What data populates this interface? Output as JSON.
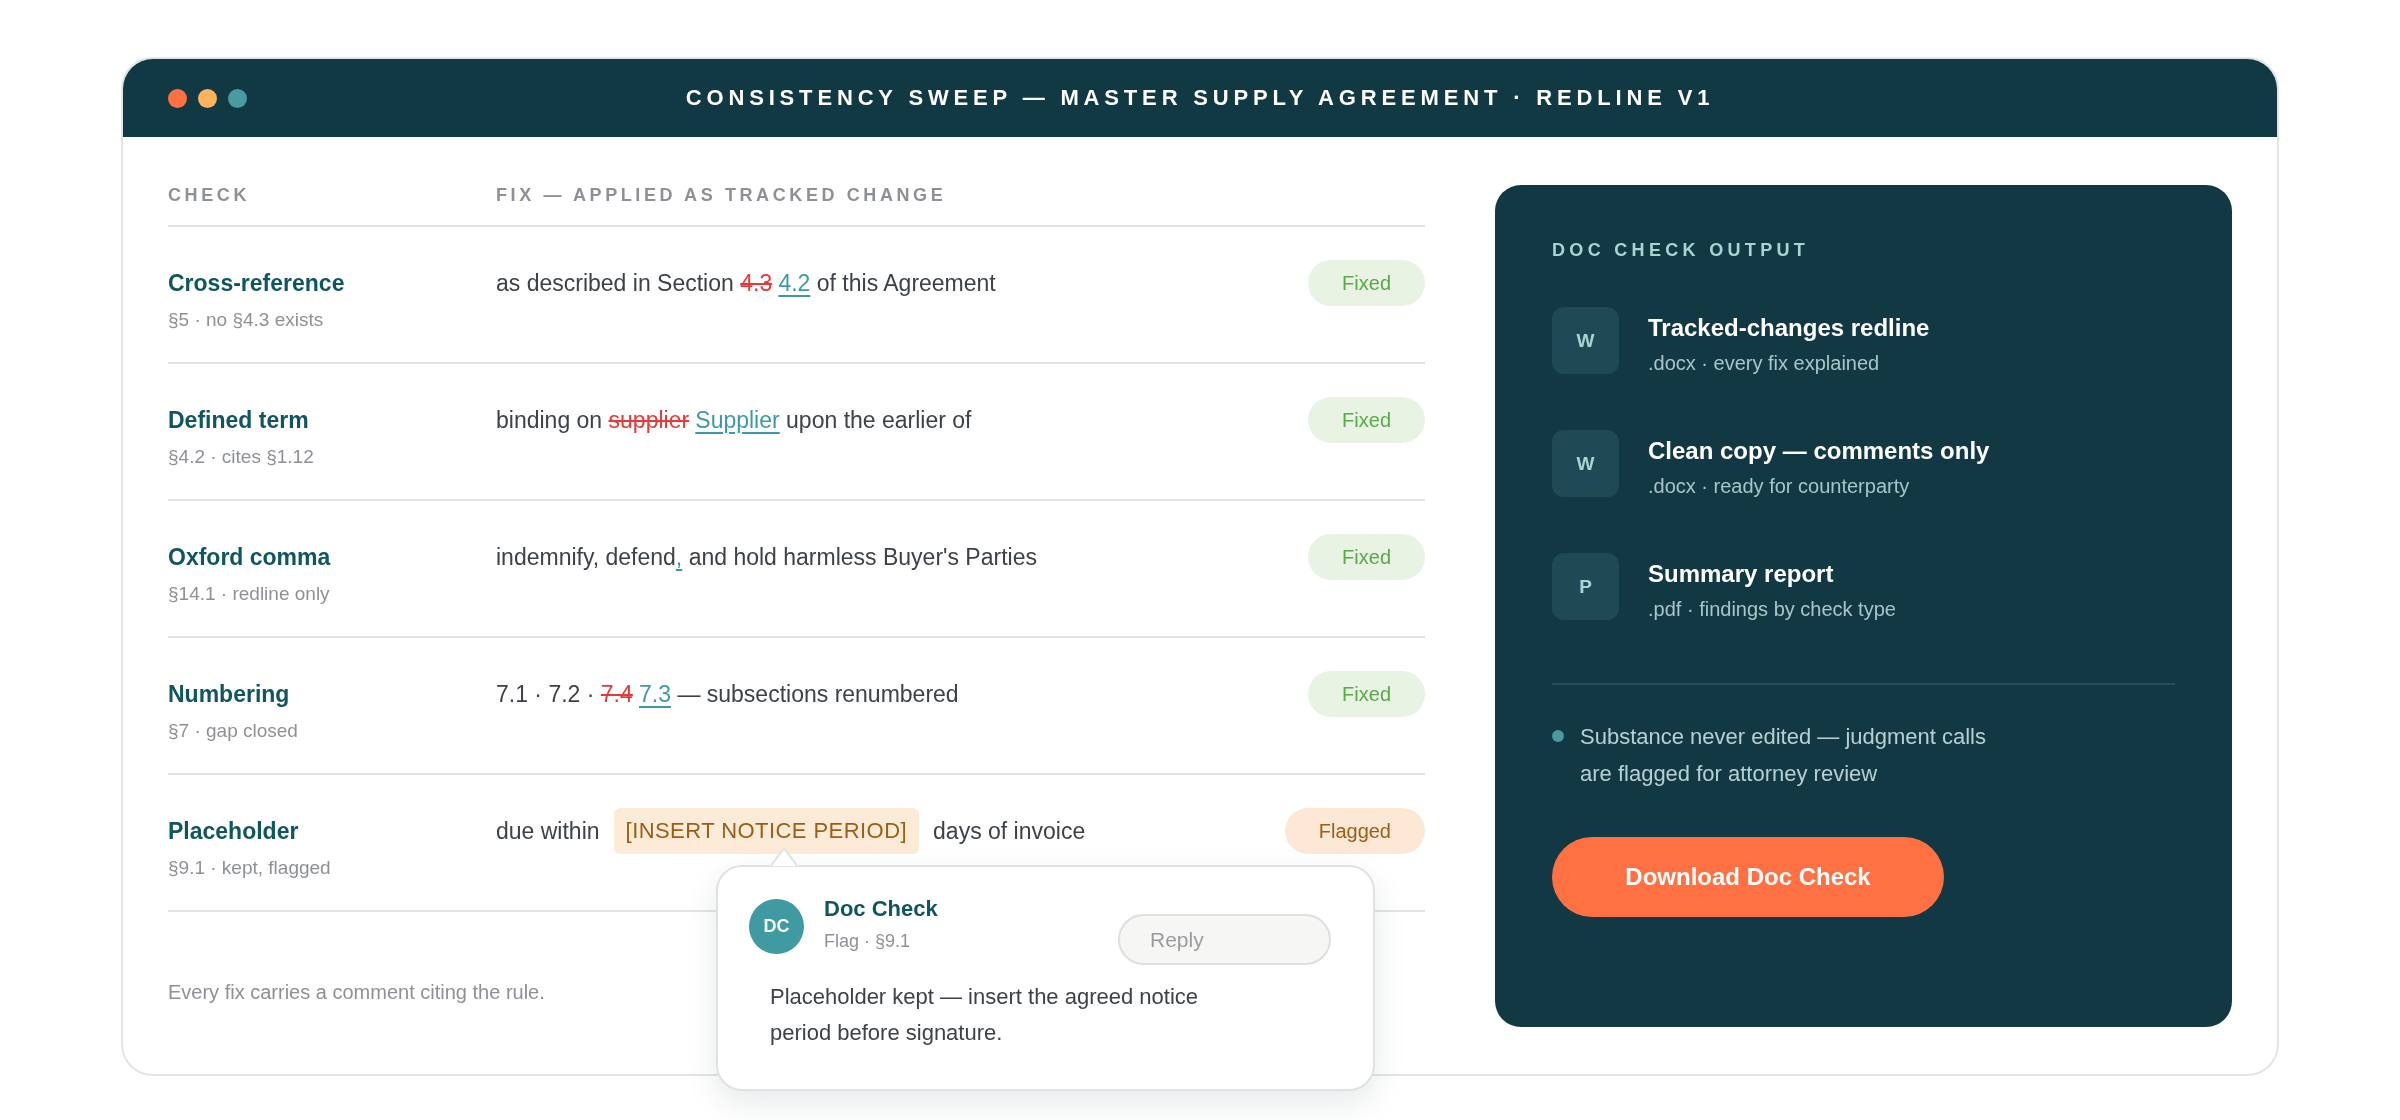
{
  "window": {
    "title": "CONSISTENCY SWEEP — MASTER SUPPLY AGREEMENT · REDLINE V1"
  },
  "table": {
    "columns": [
      "CHECK",
      "FIX — APPLIED AS TRACKED CHANGE"
    ],
    "rows": [
      {
        "check": "Cross-reference",
        "ref": "§5 · no §4.3 exists",
        "fix": [
          {
            "kind": "text",
            "text": "as described in Section "
          },
          {
            "kind": "deleted",
            "text": "4.3"
          },
          {
            "kind": "inserted",
            "text": "4.2"
          },
          {
            "kind": "text",
            "text": " of this Agreement"
          }
        ],
        "status": {
          "kind": "fixed",
          "label": "Fixed"
        }
      },
      {
        "check": "Defined term",
        "ref": "§4.2 · cites §1.12",
        "fix": [
          {
            "kind": "text",
            "text": "binding on "
          },
          {
            "kind": "deleted",
            "text": "supplier"
          },
          {
            "kind": "inserted",
            "text": "Supplier"
          },
          {
            "kind": "text",
            "text": " upon the earlier of"
          }
        ],
        "status": {
          "kind": "fixed",
          "label": "Fixed"
        }
      },
      {
        "check": "Oxford comma",
        "ref": "§14.1 · redline only",
        "fix": [
          {
            "kind": "text",
            "text": "indemnify, defend"
          },
          {
            "kind": "inserted",
            "text": ","
          },
          {
            "kind": "text",
            "text": " and hold harmless Buyer's Parties"
          }
        ],
        "status": {
          "kind": "fixed",
          "label": "Fixed"
        }
      },
      {
        "check": "Numbering",
        "ref": "§7 · gap closed",
        "fix": [
          {
            "kind": "text",
            "text": "7.1 · 7.2 · "
          },
          {
            "kind": "deleted",
            "text": "7.4"
          },
          {
            "kind": "inserted",
            "text": "7.3"
          },
          {
            "kind": "text",
            "text": " — subsections renumbered"
          }
        ],
        "status": {
          "kind": "fixed",
          "label": "Fixed"
        }
      },
      {
        "check": "Placeholder",
        "ref": "§9.1 · kept, flagged",
        "fix": [
          {
            "kind": "text",
            "text": "due within"
          },
          {
            "kind": "placeholder",
            "text": "[INSERT NOTICE PERIOD]"
          },
          {
            "kind": "text",
            "text": "days of invoice"
          }
        ],
        "status": {
          "kind": "flagged",
          "label": "Flagged"
        },
        "comment": {
          "avatar": "DC",
          "author": "Doc Check",
          "meta": "Flag · §9.1",
          "reply_placeholder": "Reply",
          "text": "Placeholder kept — insert the agreed notice period before signature."
        }
      }
    ],
    "footnote": "Every fix carries a comment citing the rule."
  },
  "output_panel": {
    "title": "DOC CHECK OUTPUT",
    "files": [
      {
        "badge": "W",
        "name": "Tracked-changes redline",
        "detail": ".docx · every fix explained"
      },
      {
        "badge": "W",
        "name": "Clean copy — comments only",
        "detail": ".docx · ready for counterparty"
      },
      {
        "badge": "P",
        "name": "Summary report",
        "detail": ".pdf · findings by check type"
      }
    ],
    "note": "Substance never edited — judgment calls are flagged for attorney review",
    "button": "Download Doc Check"
  }
}
